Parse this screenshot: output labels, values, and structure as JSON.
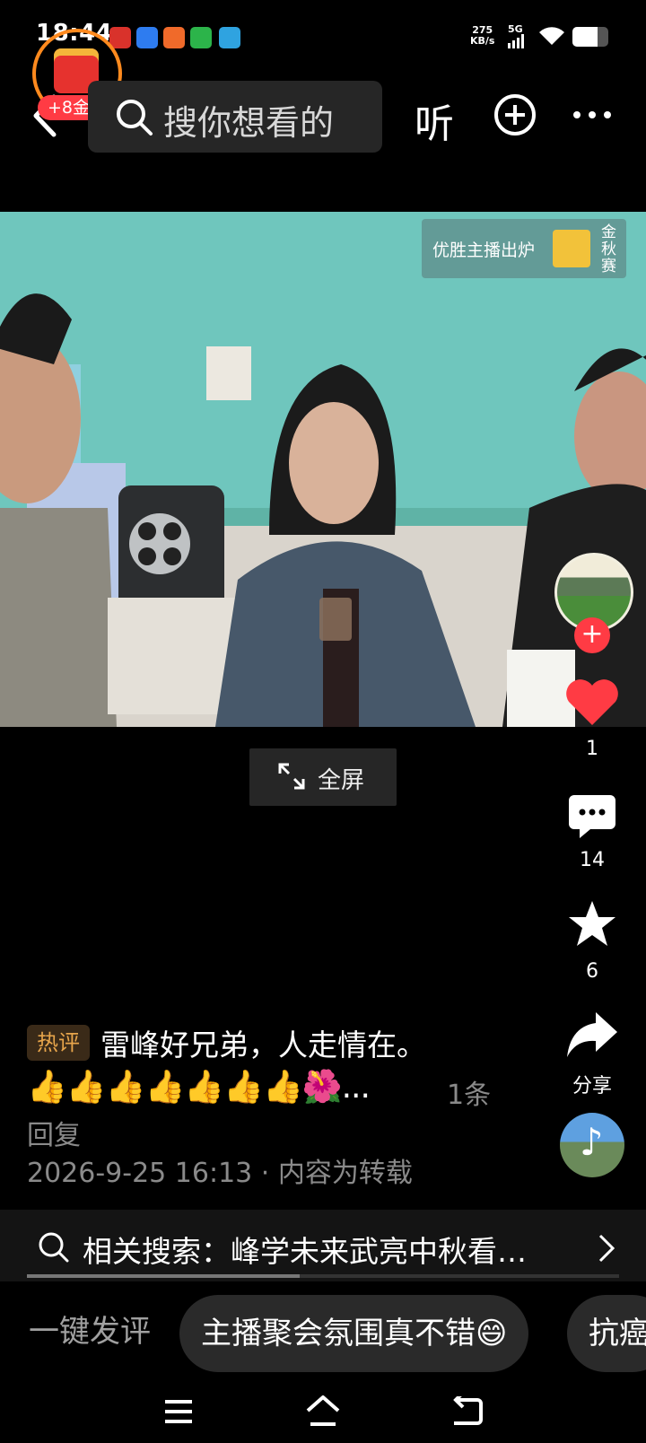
{
  "status_bar": {
    "time": "18:44",
    "net_speed_value": "275",
    "net_speed_unit": "KB/s",
    "signal_label": "5G",
    "notification_icons": [
      {
        "icon": "toutiao-icon",
        "color": "#d9322b"
      },
      {
        "icon": "cloud-app-icon",
        "color": "#2e7cf0"
      },
      {
        "icon": "dots-app-icon",
        "color": "#f06a2a"
      },
      {
        "icon": "green-app-icon",
        "color": "#2cb44a"
      },
      {
        "icon": "blue-app-icon",
        "color": "#2fa3e0"
      }
    ],
    "battery_level": 0.7
  },
  "header": {
    "coin_badge": "+8金币",
    "search_placeholder": "搜你想看的",
    "listen_label": "听"
  },
  "video": {
    "promo_text": "优胜主播出炉",
    "promo_side": "金秋赛"
  },
  "fullscreen_label": "全屏",
  "side_actions": {
    "like_count": "1",
    "comment_count": "14",
    "favorite_count": "6",
    "share_label": "分享"
  },
  "comment": {
    "badge": "热评",
    "text": "雷峰好兄弟，人走情在。",
    "emoji_line": "👍👍👍👍👍👍👍🌺...",
    "reply_count": "1条",
    "reply_label": "回复",
    "date": "2026-9-25 16:13 · 内容为转载"
  },
  "related_search": {
    "label": "相关搜索：",
    "query": "峰学未来武亮中秋看…"
  },
  "playback_progress": 0.46,
  "quick_comments": {
    "label": "一键发评",
    "chips": [
      "主播聚会氛围真不错😄",
      "抗癌"
    ]
  },
  "colors": {
    "accent_red": "#ff3b44",
    "coin_orange": "#ff8a1e",
    "hot_badge_text": "#e7a54b",
    "wall_teal": "#6fc6bd"
  }
}
